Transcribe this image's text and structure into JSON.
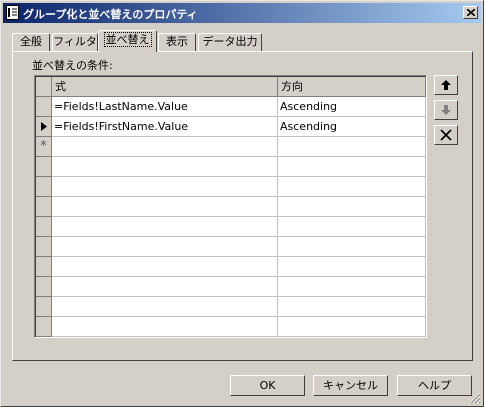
{
  "window": {
    "title": "グループ化と並べ替えのプロパティ",
    "icon": "dialog-properties-icon",
    "close_icon": "close-x-icon"
  },
  "tabs": [
    {
      "label": "全般",
      "active": false
    },
    {
      "label": "フィルタ",
      "active": false
    },
    {
      "label": "並べ替え",
      "active": true
    },
    {
      "label": "表示",
      "active": false
    },
    {
      "label": "データ出力",
      "active": false
    }
  ],
  "sort_panel": {
    "group_label": "並べ替えの条件:",
    "columns": [
      "式",
      "方向"
    ],
    "rows": [
      {
        "expression": "=Fields!LastName.Value",
        "direction": "Ascending",
        "indicator": ""
      },
      {
        "expression": "=Fields!FirstName.Value",
        "direction": "Ascending",
        "indicator": "current-row-arrow-icon"
      }
    ],
    "new_row_indicator": "*"
  },
  "side_buttons": {
    "move_up_icon": "arrow-up-icon",
    "move_down_icon": "arrow-down-icon",
    "delete_icon": "delete-x-icon"
  },
  "footer": {
    "ok": "OK",
    "cancel": "キャンセル",
    "help": "ヘルプ"
  }
}
